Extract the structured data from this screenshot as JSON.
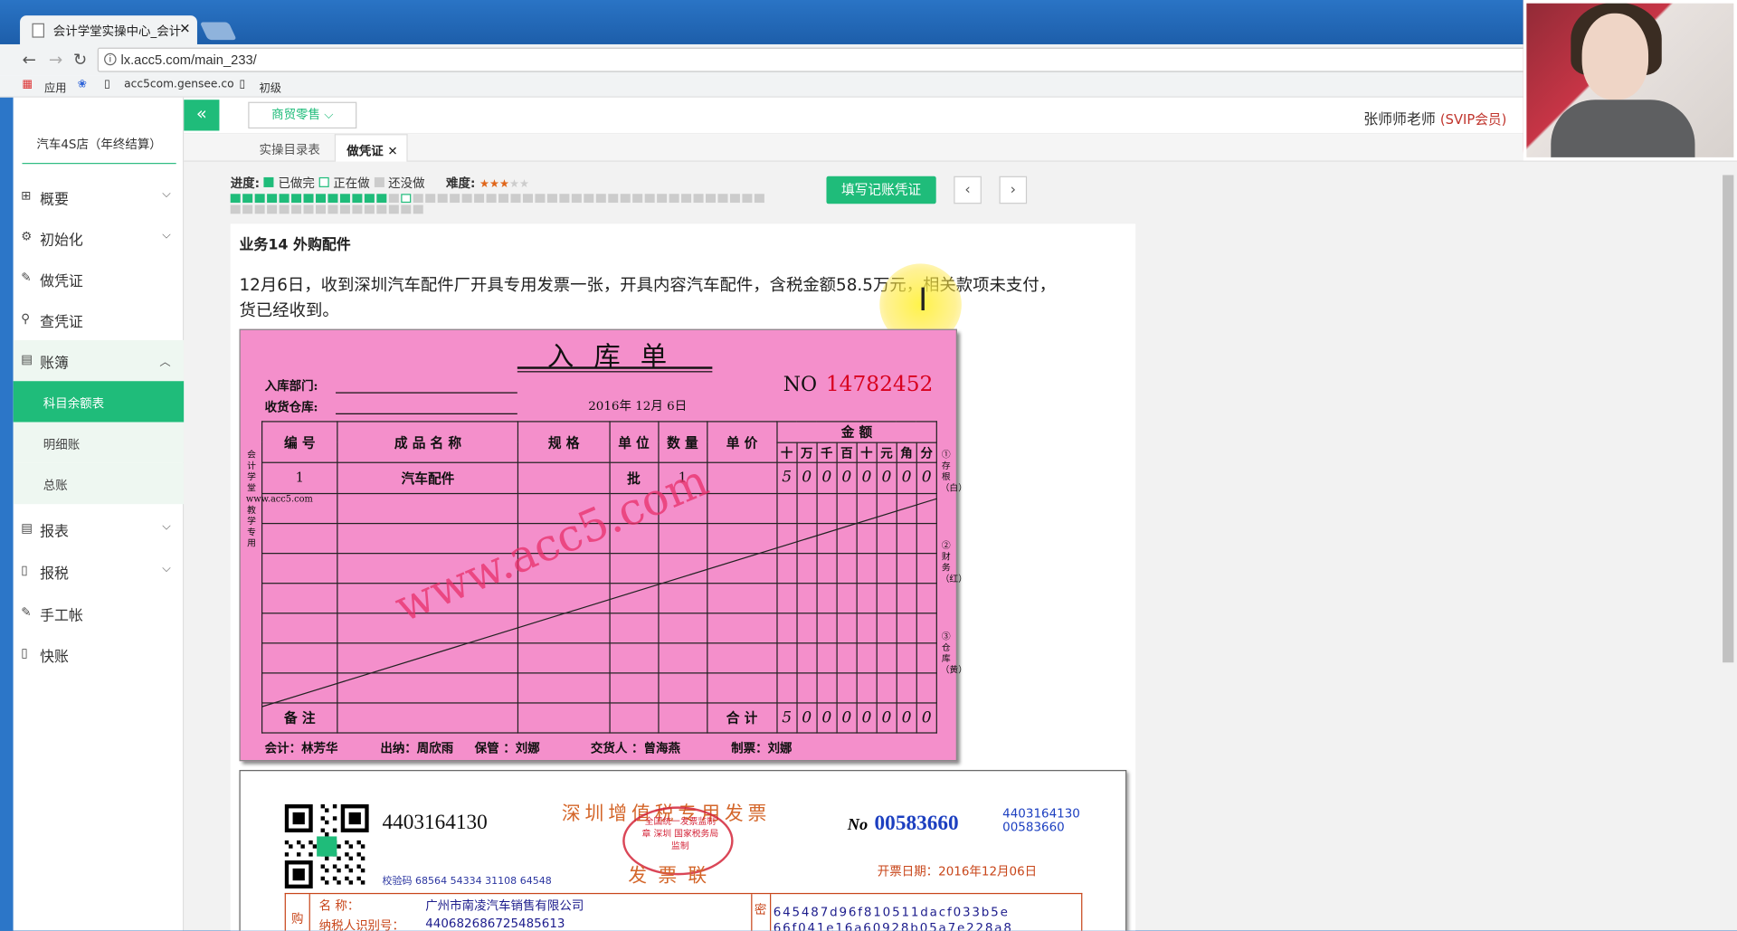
{
  "browser": {
    "tab_title": "会计学堂实操中心_会计",
    "url": "lx.acc5.com/main_233/",
    "bookmarks": [
      "应用",
      "acc5com.gensee.co",
      "初级"
    ]
  },
  "sidebar": {
    "company": "汽车4S店（年终结算）",
    "items": [
      {
        "label": "概要",
        "icon": "grid-icon"
      },
      {
        "label": "初始化",
        "icon": "gear-icon"
      },
      {
        "label": "做凭证",
        "icon": "pen-icon"
      },
      {
        "label": "查凭证",
        "icon": "search-icon"
      },
      {
        "label": "账簿",
        "icon": "ledger-icon"
      },
      {
        "label": "报表",
        "icon": "report-icon"
      },
      {
        "label": "报税",
        "icon": "document-icon"
      },
      {
        "label": "手工帐",
        "icon": "pen-icon"
      },
      {
        "label": "快账",
        "icon": "document-icon"
      }
    ],
    "subitems": [
      "科目余额表",
      "明细账",
      "总账"
    ]
  },
  "topbar": {
    "industry": "商贸零售",
    "teacher": "张师师老师",
    "member": "(SVIP会员)"
  },
  "tabs": [
    "实操目录表",
    "做凭证"
  ],
  "progress": {
    "label": "进度:",
    "done": "已做完",
    "doing": "正在做",
    "todo": "还没做",
    "difficulty": "难度:",
    "done_count": 13,
    "current_index": 14,
    "total": 60
  },
  "fill_button": "填写记账凭证",
  "business": {
    "title": "业务14 外购配件",
    "text_before": "12月6日，收到深圳汽车配件厂开具专用发票一张，开具内容汽车配件，含税金额58.5万元，相关款项未支付，",
    "text_after": "货已经收到。"
  },
  "receipt": {
    "title": "入库单",
    "dept_label": "入库部门:",
    "warehouse_label": "收货仓库:",
    "no_label": "NO",
    "no": "14782452",
    "date": "2016年 12月 6日",
    "headers": [
      "编 号",
      "成 品 名 称",
      "规 格",
      "单 位",
      "数 量",
      "单 价"
    ],
    "amount_header": "金 额",
    "digit_headers": [
      "十",
      "万",
      "千",
      "百",
      "十",
      "元",
      "角",
      "分"
    ],
    "row": {
      "no": "1",
      "name": "汽车配件",
      "spec": "",
      "unit": "批",
      "qty": "1",
      "price": ""
    },
    "row_digits": [
      "5",
      "0",
      "0",
      "0",
      "0",
      "0",
      "0",
      "0"
    ],
    "remark": "备 注",
    "total": "合 计",
    "total_digits": [
      "5",
      "0",
      "0",
      "0",
      "0",
      "0",
      "0",
      "0"
    ],
    "left_vertical": "会计学堂www.acc5.com教学专用",
    "right_vertical": [
      "①存根（白）",
      "②财务（红）",
      "③仓库（黄）"
    ],
    "footer": "会计：林芳华          出纳：周欣雨     保管 ：刘娜            交货人 ：曾海燕            制票：刘娜",
    "watermark": "www.acc5.com"
  },
  "invoice": {
    "code": "4403164130",
    "check": "校验码 68564 54334 31108 64548",
    "title": "深圳增值税专用发票",
    "subtitle": "发票联",
    "no_label": "No",
    "no": "00583660",
    "code_small": "4403164130",
    "no_small": "00583660",
    "date": "开票日期：2016年12月06日",
    "buyer_name_label": "名        称：",
    "buyer_name": "广州市南凌汽车销售有限公司",
    "tax_id_label": "纳税人识别号：",
    "tax_id": "440682686725485613",
    "buyer_tag": "购",
    "cipher_tag": "密",
    "cipher1": "6 4 5 4 8 7 d 9 6 f 8 1 0 5 1 1 d a c f 0 3 3 b 5 e",
    "cipher2": "6 6 f 0 4 1 e 1 6 a 6 0 9 2 8 b 0 5 a 7 e 2 2 8 a 8",
    "stamp": "全国统一发票监制章 深圳 国家税务局监制"
  }
}
